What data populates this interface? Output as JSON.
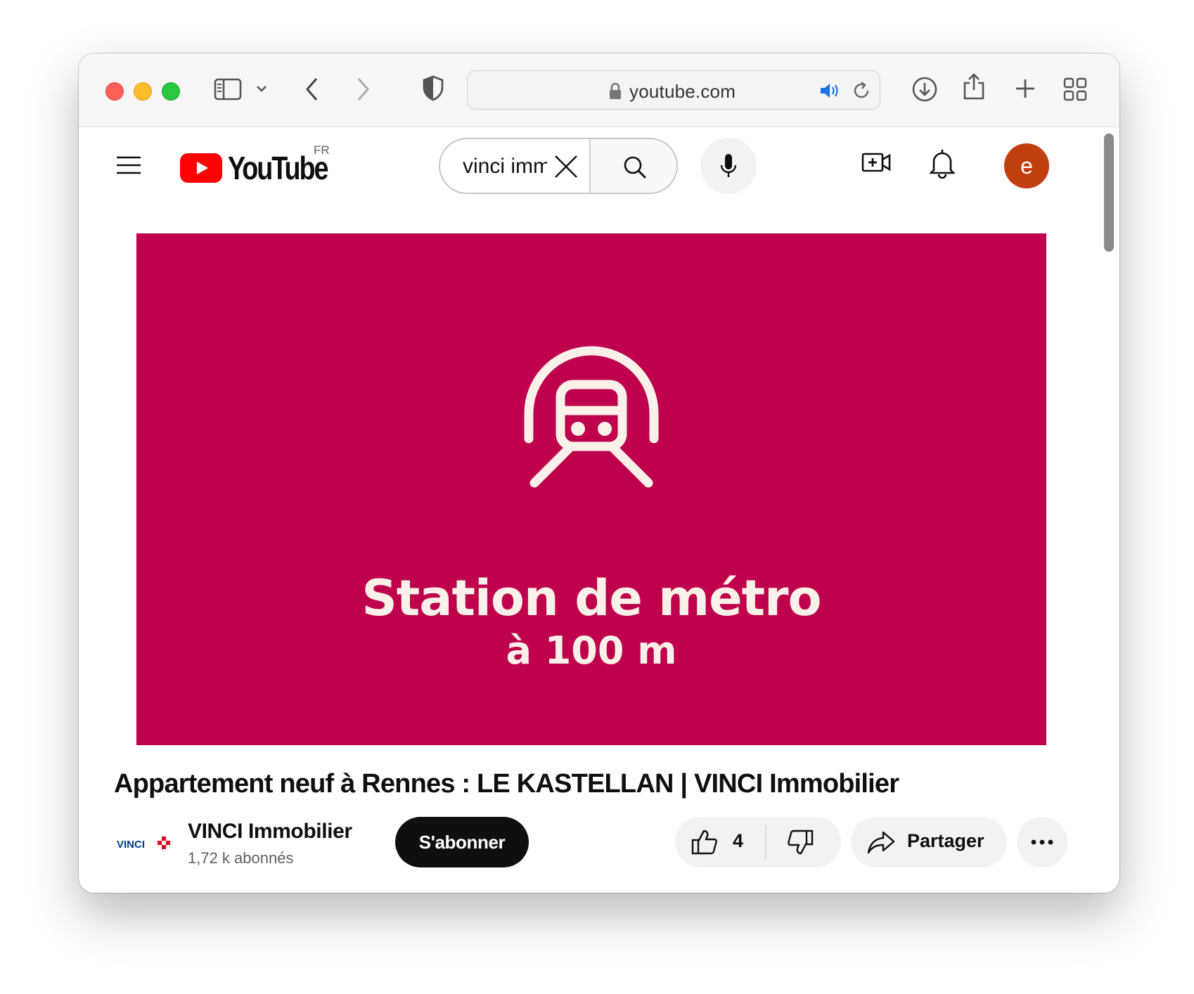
{
  "browser": {
    "url": "youtube.com",
    "icons": [
      "sidebar-icon",
      "chevron-down-icon",
      "back-icon",
      "forward-icon",
      "privacy-shield-icon",
      "lock-icon",
      "speaker-icon",
      "reload-icon",
      "download-icon",
      "share-icon",
      "new-tab-icon",
      "tab-overview-icon"
    ]
  },
  "youtube": {
    "logo_text": "YouTube",
    "country_code": "FR",
    "search": {
      "value": "vinci imm"
    },
    "avatar_letter": "e"
  },
  "video": {
    "frame_title": "Station de métro",
    "frame_subtitle": "à 100 m",
    "background_color": "#bf004c",
    "title": "Appartement neuf à Rennes : LE KASTELLAN | VINCI Immobilier"
  },
  "channel": {
    "name": "VINCI Immobilier",
    "subscribers": "1,72 k abonnés",
    "logo_text": "VINCI",
    "subscribe_label": "S'abonner"
  },
  "actions": {
    "like_count": "4",
    "share_label": "Partager"
  }
}
